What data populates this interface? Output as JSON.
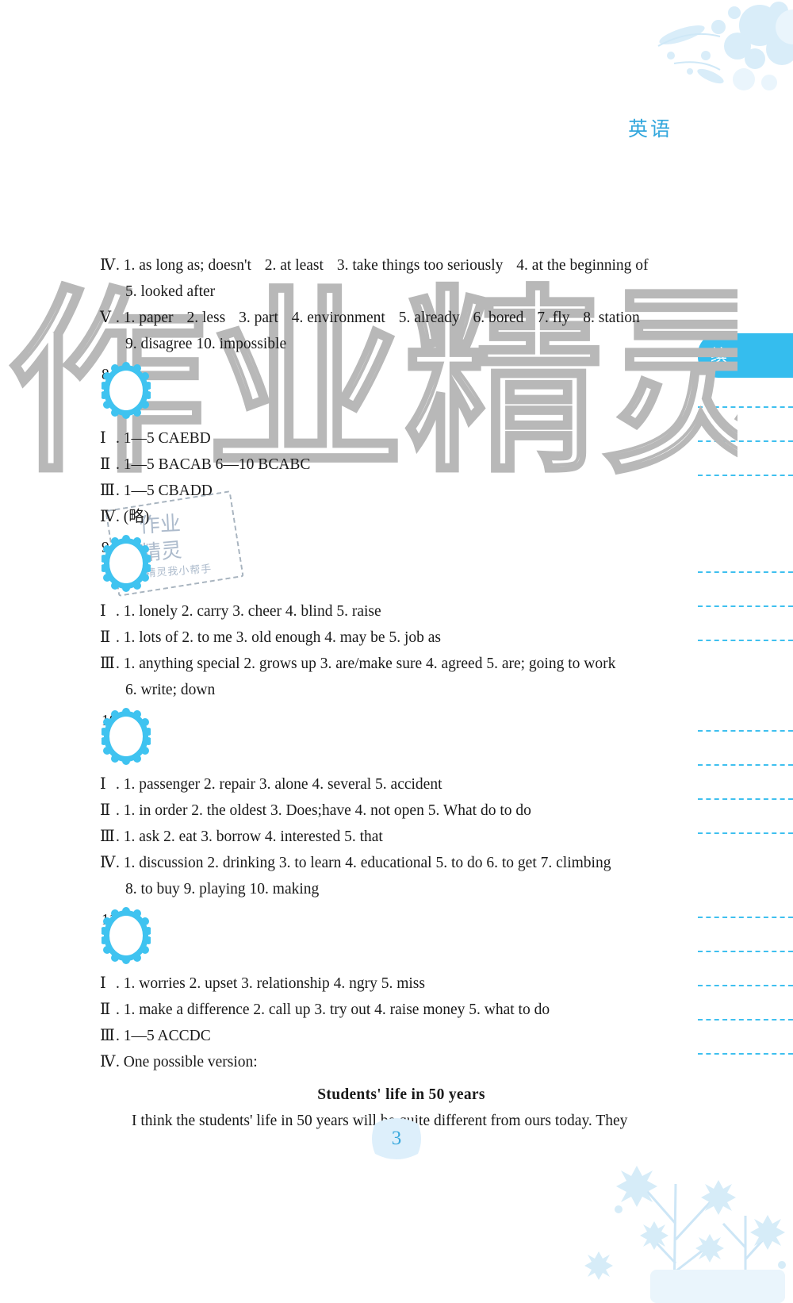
{
  "header": {
    "subject_title": "英语",
    "side_band_label": "缤"
  },
  "watermark": {
    "text": "作业精灵",
    "stamp_line1": "作业",
    "stamp_line2": "精灵",
    "stamp_line3": "作业精灵我小帮手"
  },
  "colors": {
    "accent_blue": "#35bdee",
    "title_blue": "#33a7dd",
    "badge_number": "#2b2b8f",
    "text": "#1a1a1a",
    "floral": "#d6ecf8"
  },
  "continued_section": {
    "groups": [
      {
        "roman": "Ⅳ",
        "items": [
          "1. as long as; doesn't",
          "2. at least",
          "3. take things too seriously",
          "4. at the beginning of"
        ],
        "continuation": "5. looked after"
      },
      {
        "roman": "Ⅴ",
        "items": [
          "1. paper",
          "2. less",
          "3. part",
          "4. environment",
          "5. already",
          "6. bored",
          "7. fly",
          "8. station"
        ],
        "continuation": "9. disagree   10. impossible"
      }
    ]
  },
  "sections": [
    {
      "badge": "8",
      "groups": [
        {
          "roman": "Ⅰ",
          "line": "1—5 CAEBD"
        },
        {
          "roman": "Ⅱ",
          "line": "1—5 BACAB   6—10 BCABC"
        },
        {
          "roman": "Ⅲ",
          "line": "1—5 CBADD"
        },
        {
          "roman": "Ⅳ",
          "line": "(略)"
        }
      ]
    },
    {
      "badge": "9",
      "groups": [
        {
          "roman": "Ⅰ",
          "line": "1. lonely   2. carry   3. cheer   4. blind   5. raise"
        },
        {
          "roman": "Ⅱ",
          "line": "1. lots of   2. to me   3. old enough   4. may be   5. job as"
        },
        {
          "roman": "Ⅲ",
          "line": "1. anything special   2. grows up   3. are/make sure   4. agreed   5. are; going to work",
          "continuation": "6. write; down"
        }
      ]
    },
    {
      "badge": "10",
      "groups": [
        {
          "roman": "Ⅰ",
          "line": "1. passenger   2. repair   3. alone   4. several   5. accident"
        },
        {
          "roman": "Ⅱ",
          "line": "1. in order   2. the oldest   3. Does;have   4. not open   5. What do to do"
        },
        {
          "roman": "Ⅲ",
          "line": "1. ask   2. eat   3. borrow   4. interested   5. that"
        },
        {
          "roman": "Ⅳ",
          "line": "1. discussion   2. drinking   3. to learn   4. educational   5. to do   6. to get   7. climbing",
          "continuation": "8. to buy   9. playing   10. making"
        }
      ]
    },
    {
      "badge": "11",
      "groups": [
        {
          "roman": "Ⅰ",
          "line": "1. worries   2. upset   3. relationship   4. ngry   5. miss"
        },
        {
          "roman": "Ⅱ",
          "line": "1. make a difference   2. call up   3. try out   4. raise money   5. what to do"
        },
        {
          "roman": "Ⅲ",
          "line": "1—5 ACCDC"
        },
        {
          "roman": "Ⅳ",
          "line": "One possible version:"
        }
      ],
      "composition": {
        "title": "Students' life in 50 years",
        "paragraph": "I think the students' life in 50 years will be quite different from ours today. They"
      }
    }
  ],
  "footer": {
    "page_number": "3"
  }
}
